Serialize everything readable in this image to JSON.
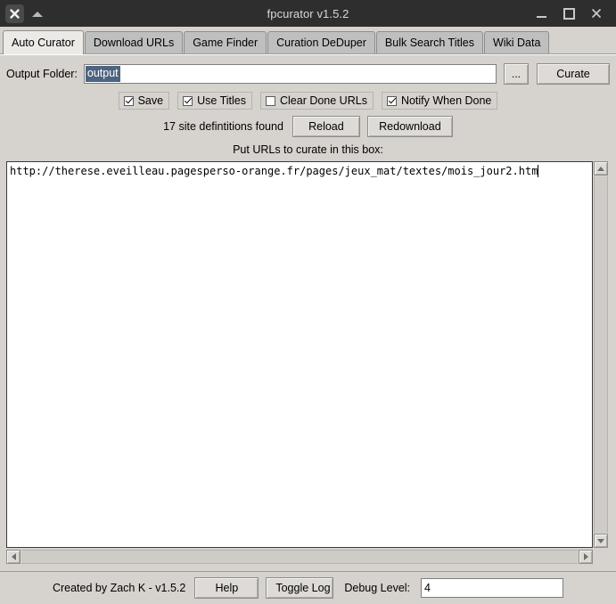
{
  "window": {
    "title": "fpcurator v1.5.2",
    "left_icons": [
      {
        "name": "close-icon",
        "glyph": "✕"
      },
      {
        "name": "collapse-triangle-icon",
        "glyph": "▲"
      }
    ],
    "controls": {
      "minimize": "—",
      "maximize": "□",
      "close": "✕"
    }
  },
  "tabs": [
    {
      "label": "Auto Curator",
      "active": true
    },
    {
      "label": "Download URLs",
      "active": false
    },
    {
      "label": "Game Finder",
      "active": false
    },
    {
      "label": "Curation DeDuper",
      "active": false
    },
    {
      "label": "Bulk Search Titles",
      "active": false
    },
    {
      "label": "Wiki Data",
      "active": false
    }
  ],
  "auto_curator": {
    "output_folder": {
      "label": "Output Folder:",
      "value": "output",
      "selected": true,
      "browse_label": "...",
      "curate_label": "Curate"
    },
    "checkboxes": [
      {
        "label": "Save",
        "checked": true
      },
      {
        "label": "Use Titles",
        "checked": true
      },
      {
        "label": "Clear Done URLs",
        "checked": false
      },
      {
        "label": "Notify When Done",
        "checked": true
      }
    ],
    "site_definitions_text": "17 site defintitions found",
    "reload_label": "Reload",
    "redownload_label": "Redownload",
    "urls_prompt": "Put URLs to curate in this box:",
    "urls_text": "http://therese.eveilleau.pagesperso-orange.fr/pages/jeux_mat/textes/mois_jour2.htm"
  },
  "statusbar": {
    "credit": "Created by Zach K - v1.5.2",
    "help_label": "Help",
    "toggle_log_label": "Toggle Log",
    "debug_level_label": "Debug Level:",
    "debug_level_value": "4"
  },
  "colors": {
    "titlebar_bg": "#2e2e2e",
    "titlebar_text": "#d8d8d8",
    "panel_bg": "#d6d2cd",
    "button_bg": "#dedad5",
    "tab_active_bg": "#eceae7",
    "tab_inactive_bg": "#bfbfbf",
    "selection_bg": "#4d6481",
    "field_bg": "#ffffff"
  }
}
